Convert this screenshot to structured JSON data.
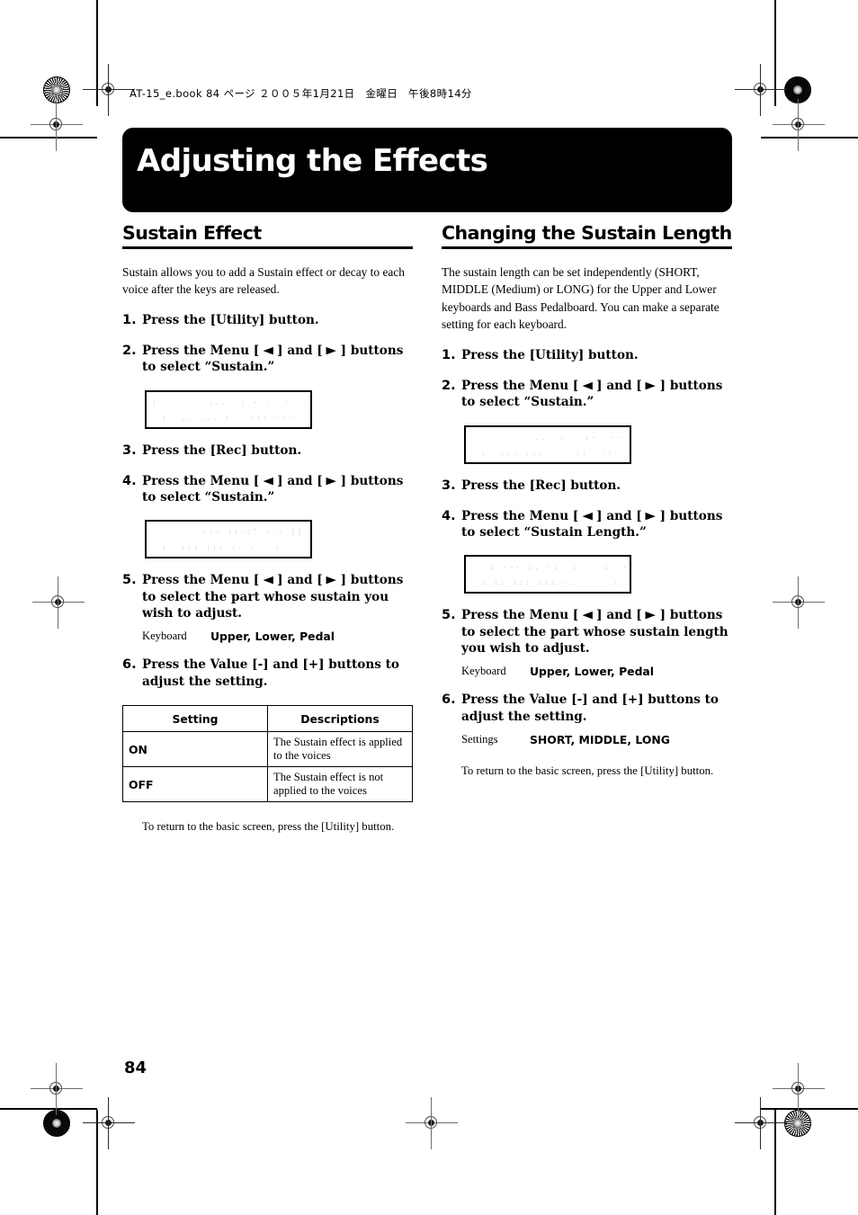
{
  "document": {
    "slug": "AT-15_e.book  84 ページ  ２００５年1月21日　金曜日　午後8時14分",
    "page_number": "84",
    "banner_title": "Adjusting the Effects"
  },
  "left_column": {
    "heading": "Sustain Effect",
    "intro": "Sustain allows you to add a Sustain effect or decay to each voice after the keys are released.",
    "steps": [
      {
        "num": "1.",
        "text": "Press the [Utility] button."
      },
      {
        "num": "2.",
        "text_before": "Press the Menu [ ",
        "arrow_left": "◀",
        "text_mid": " ] and [ ",
        "arrow_right": "▶",
        "text_after": " ] buttons to select “Sustain.”"
      },
      {
        "num": "3.",
        "text": "Press the [Rec] button."
      },
      {
        "num": "4.",
        "text_before": "Press the Menu [ ",
        "arrow_left": "◀",
        "text_mid": " ] and [ ",
        "arrow_right": "▶",
        "text_after": " ] buttons to select “Sustain.”"
      },
      {
        "num": "5.",
        "text_before": "Press the Menu [ ",
        "arrow_left": "◀",
        "text_mid": " ] and [ ",
        "arrow_right": "▶",
        "text_after": " ] buttons to select the part whose sustain you wish to adjust."
      },
      {
        "num": "6.",
        "text": "Press the Value [-] and [+] buttons to adjust the setting."
      }
    ],
    "lcd_1": {
      "line1": ":        ...  : · ·  ·  ·; ··            ::",
      "line2": " :  .. ... :   ·:: ·:·"
    },
    "lcd_2": {
      "line1": "        ··· ::·:' ·.· ]] ·’         ::",
      "line2": " :  ::: ::: :· ·   :      : ·"
    },
    "param": {
      "label": "Keyboard",
      "value": "Upper, Lower, Pedal"
    },
    "table": {
      "headers": [
        "Setting",
        "Descriptions"
      ],
      "rows": [
        [
          "ON",
          "The Sustain effect is applied to the voices"
        ],
        [
          "OFF",
          "The Sustain effect is not applied to the voices"
        ]
      ]
    },
    "footnote": "To return to the basic screen, press the [Utility] button."
  },
  "right_column": {
    "heading": "Changing the Sustain Length",
    "intro": "The sustain length can be set independently (SHORT, MIDDLE (Medium) or LONG) for the Upper and Lower keyboards and Bass Pedalboard. You can make a separate setting for each keyboard.",
    "steps": [
      {
        "num": "1.",
        "text": "Press the [Utility] button."
      },
      {
        "num": "2.",
        "text_before": "Press the Menu [ ",
        "arrow_left": "◀",
        "text_mid": " ] and [ ",
        "arrow_right": "▶",
        "text_after": " ] buttons to select “Sustain.”"
      },
      {
        "num": "3.",
        "text": "Press the [Rec] button."
      },
      {
        "num": "4.",
        "text_before": "Press the Menu [ ",
        "arrow_left": "◀",
        "text_mid": " ] and [ ",
        "arrow_right": "▶",
        "text_after": " ] buttons to select “Sustain Length.”"
      },
      {
        "num": "5.",
        "text_before": "Press the Menu [ ",
        "arrow_left": "◀",
        "text_mid": " ] and [ ",
        "arrow_right": "▶",
        "text_after": " ] buttons to select the part whose sustain length you wish to adjust."
      },
      {
        "num": "6.",
        "text": "Press the Value [-] and [+] buttons to adjust the setting."
      }
    ],
    "lcd_1": {
      "line1": "          ..  :   :·  ··  ·;  ··.       ::",
      "line2": " :  ... ...     ::  ·:·"
    },
    "lcd_2": {
      "line1": "   : ·-- :. ·:  :    :  ··· : ::   ]·  :.",
      "line2": " : :: ::: ::: ·.      :     : ·:  ·;"
    },
    "param_keyboard": {
      "label": "Keyboard",
      "value": "Upper, Lower, Pedal"
    },
    "param_settings": {
      "label": "Settings",
      "value": "SHORT, MIDDLE, LONG"
    },
    "footnote": "To return to the basic screen, press the [Utility] button."
  }
}
